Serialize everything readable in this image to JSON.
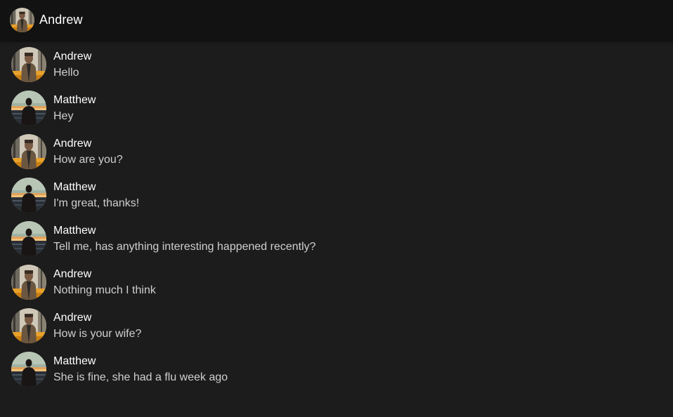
{
  "header": {
    "title": "Andrew",
    "avatar_icon": "andrew-avatar"
  },
  "messages": [
    {
      "author": "Andrew",
      "text": "Hello",
      "avatar": "andrew"
    },
    {
      "author": "Matthew",
      "text": "Hey",
      "avatar": "matthew"
    },
    {
      "author": "Andrew",
      "text": "How are you?",
      "avatar": "andrew"
    },
    {
      "author": "Matthew",
      "text": "I'm great, thanks!",
      "avatar": "matthew"
    },
    {
      "author": "Matthew",
      "text": "Tell me, has anything interesting happened recently?",
      "avatar": "matthew"
    },
    {
      "author": "Andrew",
      "text": "Nothing much I think",
      "avatar": "andrew"
    },
    {
      "author": "Andrew",
      "text": "How is your wife?",
      "avatar": "andrew"
    },
    {
      "author": "Matthew",
      "text": "She is fine, she had a flu week ago",
      "avatar": "matthew"
    }
  ],
  "colors": {
    "background": "#1c1c1c",
    "header": "#121212",
    "author_text": "#ffffff",
    "message_text": "#cfcfcf"
  }
}
